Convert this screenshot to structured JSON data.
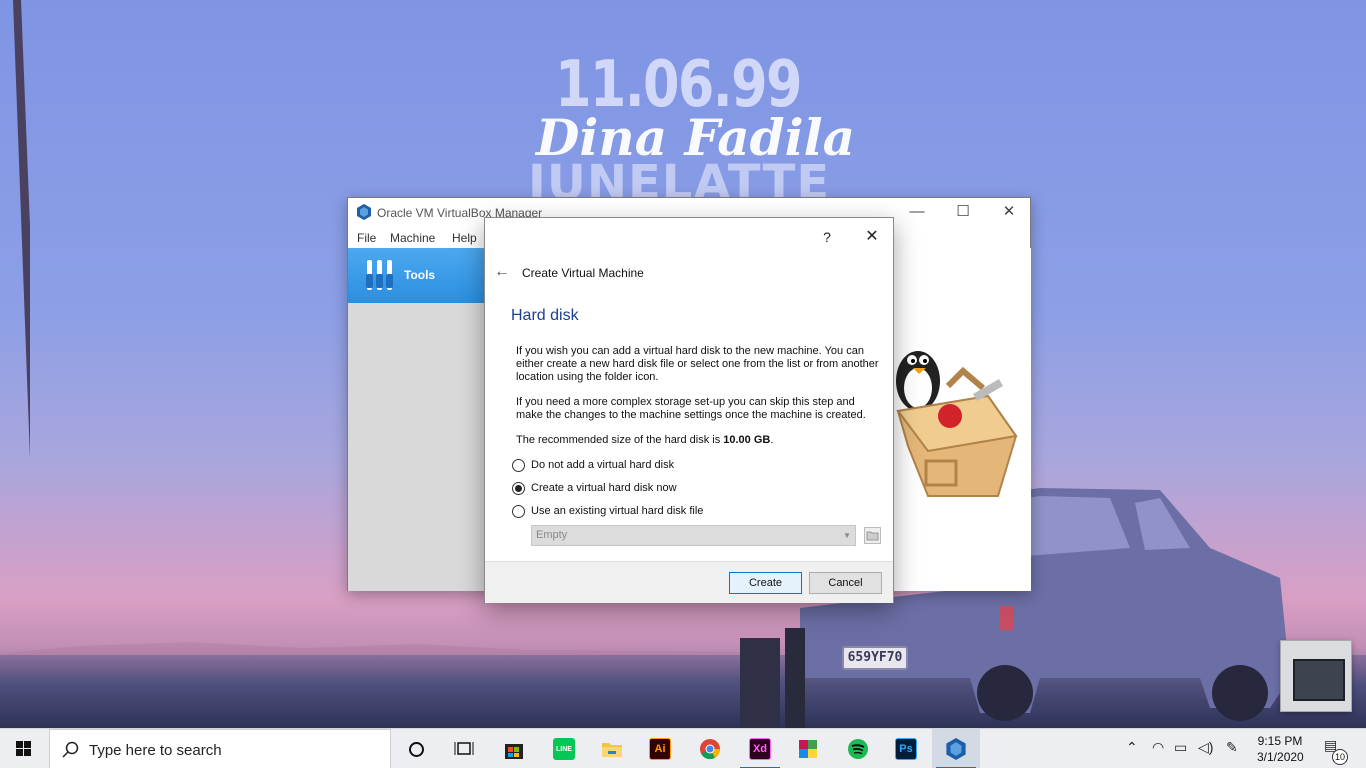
{
  "wallpaper": {
    "date_text": "11.06.99",
    "name_text": "Dina Fadila",
    "brand_text": "JUNELATTE",
    "license_plate": "659YF70"
  },
  "vbox_window": {
    "title": "Oracle VM VirtualBox Manager",
    "menu": [
      "File",
      "Machine",
      "Help"
    ],
    "sidebar_tools_label": "Tools",
    "controls": {
      "minimize": "—",
      "maximize": "☐",
      "close": "✕"
    }
  },
  "dialog": {
    "help_label": "?",
    "close_label": "✕",
    "back_label": "←",
    "heading": "Create Virtual Machine",
    "page_title": "Hard disk",
    "paragraph1": "If you wish you can add a virtual hard disk to the new machine. You can either create a new hard disk file or select one from the list or from another location using the folder icon.",
    "paragraph2": "If you need a more complex storage set-up you can skip this step and make the changes to the machine settings once the machine is created.",
    "recommended_prefix": "The recommended size of the hard disk is ",
    "recommended_value": "10.00 GB",
    "recommended_suffix": ".",
    "options": [
      {
        "label": "Do not add a virtual hard disk",
        "checked": false
      },
      {
        "label": "Create a virtual hard disk now",
        "checked": true
      },
      {
        "label": "Use an existing virtual hard disk file",
        "checked": false
      }
    ],
    "disk_select_value": "Empty",
    "buttons": {
      "create": "Create",
      "cancel": "Cancel"
    }
  },
  "taskbar": {
    "search_placeholder": "Type here to search",
    "apps": [
      {
        "name": "task-view-icon",
        "label": ""
      },
      {
        "name": "microsoft-store-icon",
        "label": ""
      },
      {
        "name": "line-icon",
        "label": "LINE"
      },
      {
        "name": "file-explorer-icon",
        "label": ""
      },
      {
        "name": "illustrator-icon",
        "label": "Ai"
      },
      {
        "name": "chrome-icon",
        "label": ""
      },
      {
        "name": "xd-icon",
        "label": "Xd"
      },
      {
        "name": "winrar-icon",
        "label": ""
      },
      {
        "name": "spotify-icon",
        "label": ""
      },
      {
        "name": "photoshop-icon",
        "label": "Ps"
      },
      {
        "name": "virtualbox-icon",
        "label": ""
      }
    ],
    "clock_time": "9:15 PM",
    "clock_date": "3/1/2020",
    "notification_count": "10"
  },
  "colors": {
    "accent": "#0078d7",
    "tools_selection": "#2b8fe0",
    "dialog_title": "#1c3f94"
  }
}
